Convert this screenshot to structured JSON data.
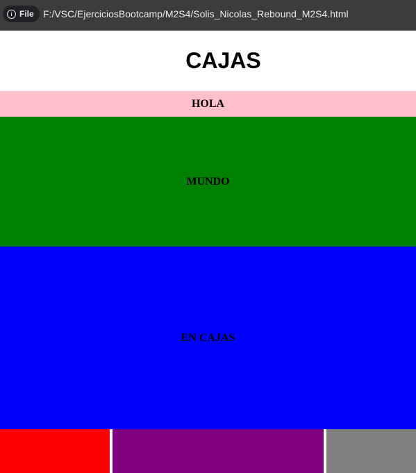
{
  "browser": {
    "site_chip_label": "File",
    "url": "F:/VSC/EjerciciosBootcamp/M2S4/Solis_Nicolas_Rebound_M2S4.html"
  },
  "page": {
    "title": "CAJAS",
    "boxes": [
      {
        "label": "HOLA",
        "color": "#ffc0cb"
      },
      {
        "label": "MUNDO",
        "color": "#008000"
      },
      {
        "label": "EN CAJAS",
        "color": "#0000ff"
      }
    ],
    "footer_boxes": [
      {
        "color": "#ff0000"
      },
      {
        "color": "#800080"
      },
      {
        "color": "#808080"
      }
    ]
  }
}
